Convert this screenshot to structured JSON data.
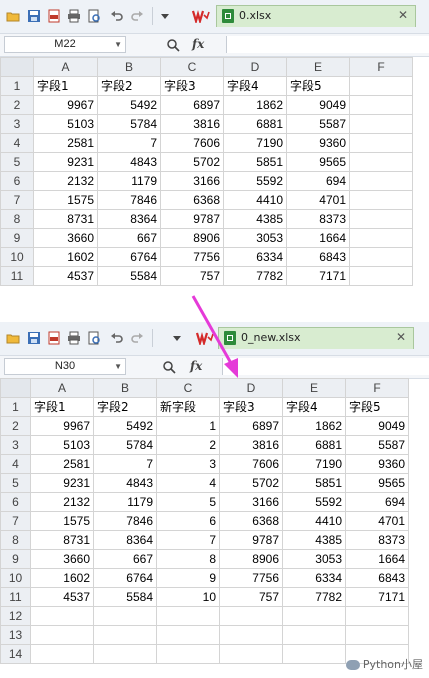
{
  "top": {
    "file_tab": "0.xlsx",
    "close_glyph": "✕",
    "name_box": "M22",
    "fx_label": "fx",
    "columns": [
      "A",
      "B",
      "C",
      "D",
      "E",
      "F"
    ],
    "row_numbers": [
      "1",
      "2",
      "3",
      "4",
      "5",
      "6",
      "7",
      "8",
      "9",
      "10",
      "11"
    ],
    "header": [
      "字段1",
      "字段2",
      "字段3",
      "字段4",
      "字段5",
      ""
    ],
    "rows": [
      [
        "9967",
        "5492",
        "6897",
        "1862",
        "9049",
        ""
      ],
      [
        "5103",
        "5784",
        "3816",
        "6881",
        "5587",
        ""
      ],
      [
        "2581",
        "7",
        "7606",
        "7190",
        "9360",
        ""
      ],
      [
        "9231",
        "4843",
        "5702",
        "5851",
        "9565",
        ""
      ],
      [
        "2132",
        "1179",
        "3166",
        "5592",
        "694",
        ""
      ],
      [
        "1575",
        "7846",
        "6368",
        "4410",
        "4701",
        ""
      ],
      [
        "8731",
        "8364",
        "9787",
        "4385",
        "8373",
        ""
      ],
      [
        "3660",
        "667",
        "8906",
        "3053",
        "1664",
        ""
      ],
      [
        "1602",
        "6764",
        "7756",
        "6334",
        "6843",
        ""
      ],
      [
        "4537",
        "5584",
        "757",
        "7782",
        "7171",
        ""
      ]
    ]
  },
  "bottom": {
    "file_tab": "0_new.xlsx",
    "close_glyph": "✕",
    "name_box": "N30",
    "fx_label": "fx",
    "columns": [
      "A",
      "B",
      "C",
      "D",
      "E",
      "F"
    ],
    "row_numbers": [
      "1",
      "2",
      "3",
      "4",
      "5",
      "6",
      "7",
      "8",
      "9",
      "10",
      "11",
      "12",
      "13",
      "14"
    ],
    "header": [
      "字段1",
      "字段2",
      "新字段",
      "字段3",
      "字段4",
      "字段5"
    ],
    "rows": [
      [
        "9967",
        "5492",
        "1",
        "6897",
        "1862",
        "9049"
      ],
      [
        "5103",
        "5784",
        "2",
        "3816",
        "6881",
        "5587"
      ],
      [
        "2581",
        "7",
        "3",
        "7606",
        "7190",
        "9360"
      ],
      [
        "9231",
        "4843",
        "4",
        "5702",
        "5851",
        "9565"
      ],
      [
        "2132",
        "1179",
        "5",
        "3166",
        "5592",
        "694"
      ],
      [
        "1575",
        "7846",
        "6",
        "6368",
        "4410",
        "4701"
      ],
      [
        "8731",
        "8364",
        "7",
        "9787",
        "4385",
        "8373"
      ],
      [
        "3660",
        "667",
        "8",
        "8906",
        "3053",
        "1664"
      ],
      [
        "1602",
        "6764",
        "9",
        "7756",
        "6334",
        "6843"
      ],
      [
        "4537",
        "5584",
        "10",
        "757",
        "7782",
        "7171"
      ],
      [
        "",
        "",
        "",
        "",
        "",
        ""
      ],
      [
        "",
        "",
        "",
        "",
        "",
        ""
      ],
      [
        "",
        "",
        "",
        "",
        "",
        ""
      ]
    ]
  },
  "watermark": "Python小屋",
  "colors": {
    "arrow": "#e53ad8",
    "file_tab_bg": "#d8ecd0",
    "wps_red": "#d42a2a"
  }
}
